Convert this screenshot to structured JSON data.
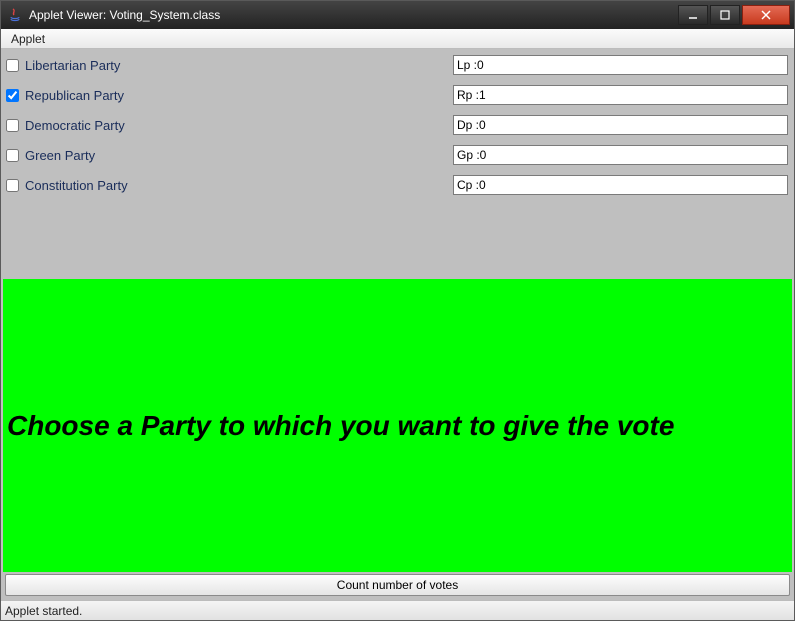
{
  "window": {
    "title": "Applet Viewer: Voting_System.class"
  },
  "menubar": {
    "applet": "Applet"
  },
  "parties": [
    {
      "label": "Libertarian Party",
      "checked": false,
      "field": "Lp :0"
    },
    {
      "label": "Republican Party",
      "checked": true,
      "field": "Rp :1"
    },
    {
      "label": "Democratic Party",
      "checked": false,
      "field": "Dp :0"
    },
    {
      "label": "Green Party",
      "checked": false,
      "field": "Gp :0"
    },
    {
      "label": "Constitution Party",
      "checked": false,
      "field": "Cp :0"
    }
  ],
  "prompt": "Choose a Party to which you want to give the vote",
  "count_button": "Count number of votes",
  "status": "Applet started."
}
